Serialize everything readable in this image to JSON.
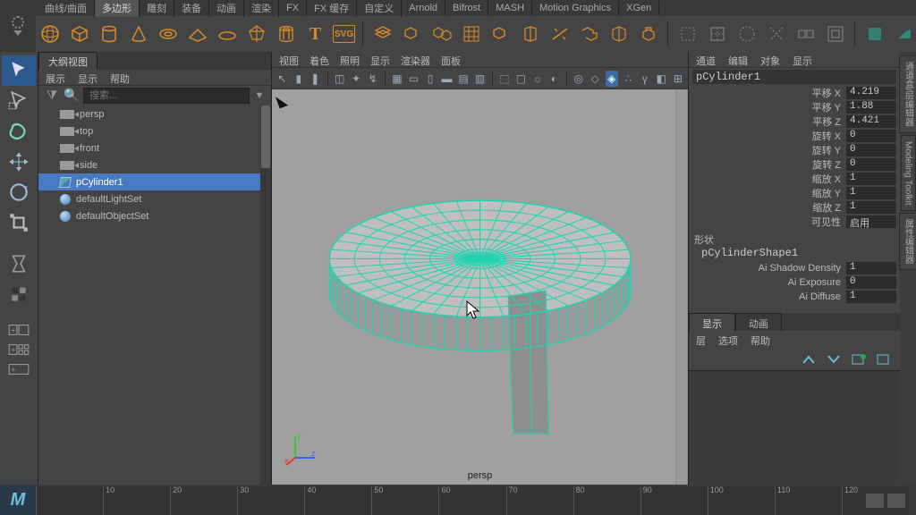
{
  "shelf": {
    "tabs": [
      "曲线/曲面",
      "多边形",
      "雕刻",
      "装备",
      "动画",
      "渲染",
      "FX",
      "FX 缓存",
      "自定义",
      "Arnold",
      "Bifrost",
      "MASH",
      "Motion Graphics",
      "XGen"
    ],
    "active": "多边形"
  },
  "outliner": {
    "title": "大纲视图",
    "menus": [
      "展示",
      "显示",
      "帮助"
    ],
    "search_placeholder": "搜索...",
    "items": [
      {
        "type": "cam",
        "label": "persp"
      },
      {
        "type": "cam",
        "label": "top"
      },
      {
        "type": "cam",
        "label": "front"
      },
      {
        "type": "cam",
        "label": "side"
      },
      {
        "type": "mesh",
        "label": "pCylinder1",
        "selected": true
      },
      {
        "type": "set",
        "label": "defaultLightSet"
      },
      {
        "type": "set",
        "label": "defaultObjectSet"
      }
    ]
  },
  "viewport": {
    "menus": [
      "视图",
      "着色",
      "照明",
      "显示",
      "渲染器",
      "面板"
    ],
    "camera_label": "persp",
    "axis": {
      "x": "x",
      "y": "y",
      "z": "z"
    }
  },
  "channel": {
    "menus": [
      "通道",
      "编辑",
      "对象",
      "显示"
    ],
    "object_name": "pCylinder1",
    "attrs": [
      {
        "label": "平移 X",
        "value": "4.219"
      },
      {
        "label": "平移 Y",
        "value": "1.88"
      },
      {
        "label": "平移 Z",
        "value": "4.421"
      },
      {
        "label": "旋转 X",
        "value": "0"
      },
      {
        "label": "旋转 Y",
        "value": "0"
      },
      {
        "label": "旋转 Z",
        "value": "0"
      },
      {
        "label": "缩放 X",
        "value": "1"
      },
      {
        "label": "缩放 Y",
        "value": "1"
      },
      {
        "label": "缩放 Z",
        "value": "1"
      },
      {
        "label": "可见性",
        "value": "启用"
      }
    ],
    "shape_header": "形状",
    "shape_name": "pCylinderShape1",
    "shape_attrs": [
      {
        "label": "Ai Shadow Density",
        "value": "1"
      },
      {
        "label": "Ai Exposure",
        "value": "0"
      },
      {
        "label": "Ai Diffuse",
        "value": "1"
      }
    ]
  },
  "layers": {
    "tabs": [
      "显示",
      "动画"
    ],
    "active": "显示",
    "menus": [
      "层",
      "选项",
      "帮助"
    ]
  },
  "vstrip": [
    "通道盒/层编辑器",
    "Modeling Toolkit",
    "属性编辑器"
  ],
  "timeline": {
    "ticks": [
      "",
      "10",
      "20",
      "30",
      "40",
      "50",
      "60",
      "70",
      "80",
      "90",
      "100",
      "110",
      "120"
    ]
  }
}
